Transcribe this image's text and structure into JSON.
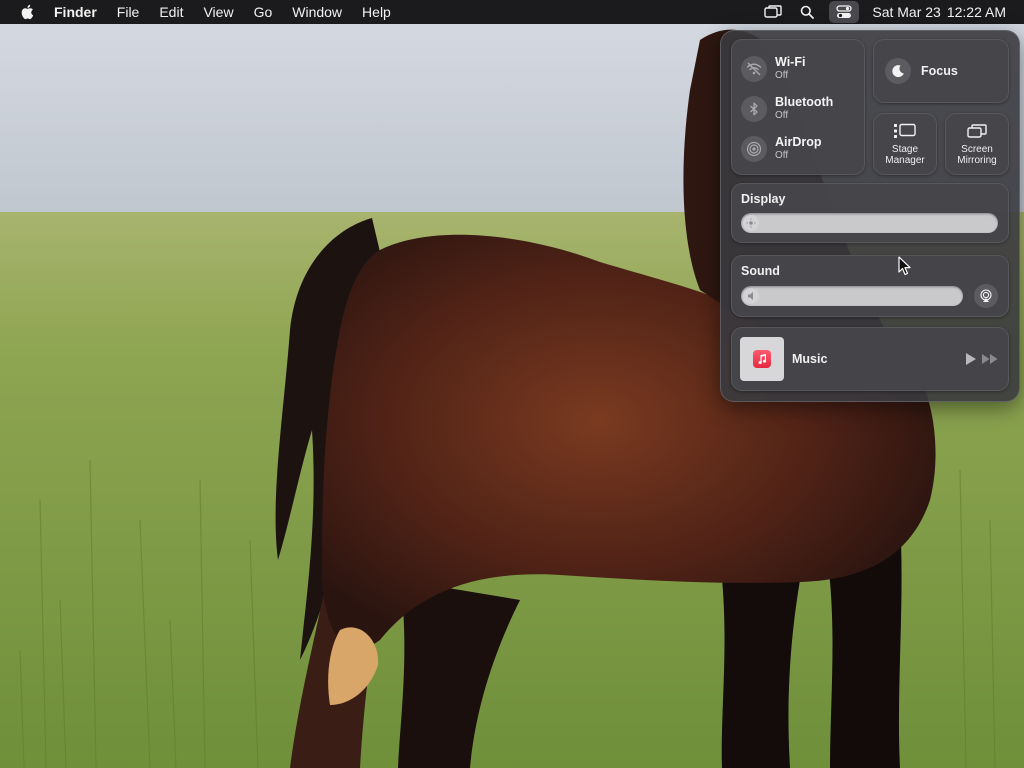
{
  "menubar": {
    "apple_icon": "apple-logo-icon",
    "app_name": "Finder",
    "menus": [
      "File",
      "Edit",
      "View",
      "Go",
      "Window",
      "Help"
    ],
    "status_icons": [
      "screen-mirroring-icon",
      "search-icon",
      "control-center-icon"
    ],
    "date": "Sat Mar 23",
    "time": "12:22 AM"
  },
  "control_center": {
    "wifi": {
      "label": "Wi-Fi",
      "status": "Off",
      "icon": "wifi-off-icon"
    },
    "bluetooth": {
      "label": "Bluetooth",
      "status": "Off",
      "icon": "bluetooth-icon"
    },
    "airdrop": {
      "label": "AirDrop",
      "status": "Off",
      "icon": "airdrop-icon"
    },
    "focus": {
      "label": "Focus",
      "icon": "moon-icon"
    },
    "stage_manager": {
      "label_line1": "Stage",
      "label_line2": "Manager",
      "icon": "stage-manager-icon"
    },
    "screen_mirroring": {
      "label_line1": "Screen",
      "label_line2": "Mirroring",
      "icon": "screen-mirroring-icon"
    },
    "display": {
      "title": "Display",
      "icon": "brightness-icon"
    },
    "sound": {
      "title": "Sound",
      "icon": "speaker-icon",
      "output_icon": "airplay-audio-icon"
    },
    "now_playing": {
      "app": "Music",
      "icon": "music-note-icon",
      "play_icon": "play-icon",
      "forward_icon": "fast-forward-icon"
    }
  },
  "colors": {
    "menubar_bg": "#1b1b1d",
    "panel_bg": "#3a3a3e",
    "tile_bg": "#46464a",
    "slider_track": "#c9c9cc",
    "music_badge": "#e5283f"
  }
}
